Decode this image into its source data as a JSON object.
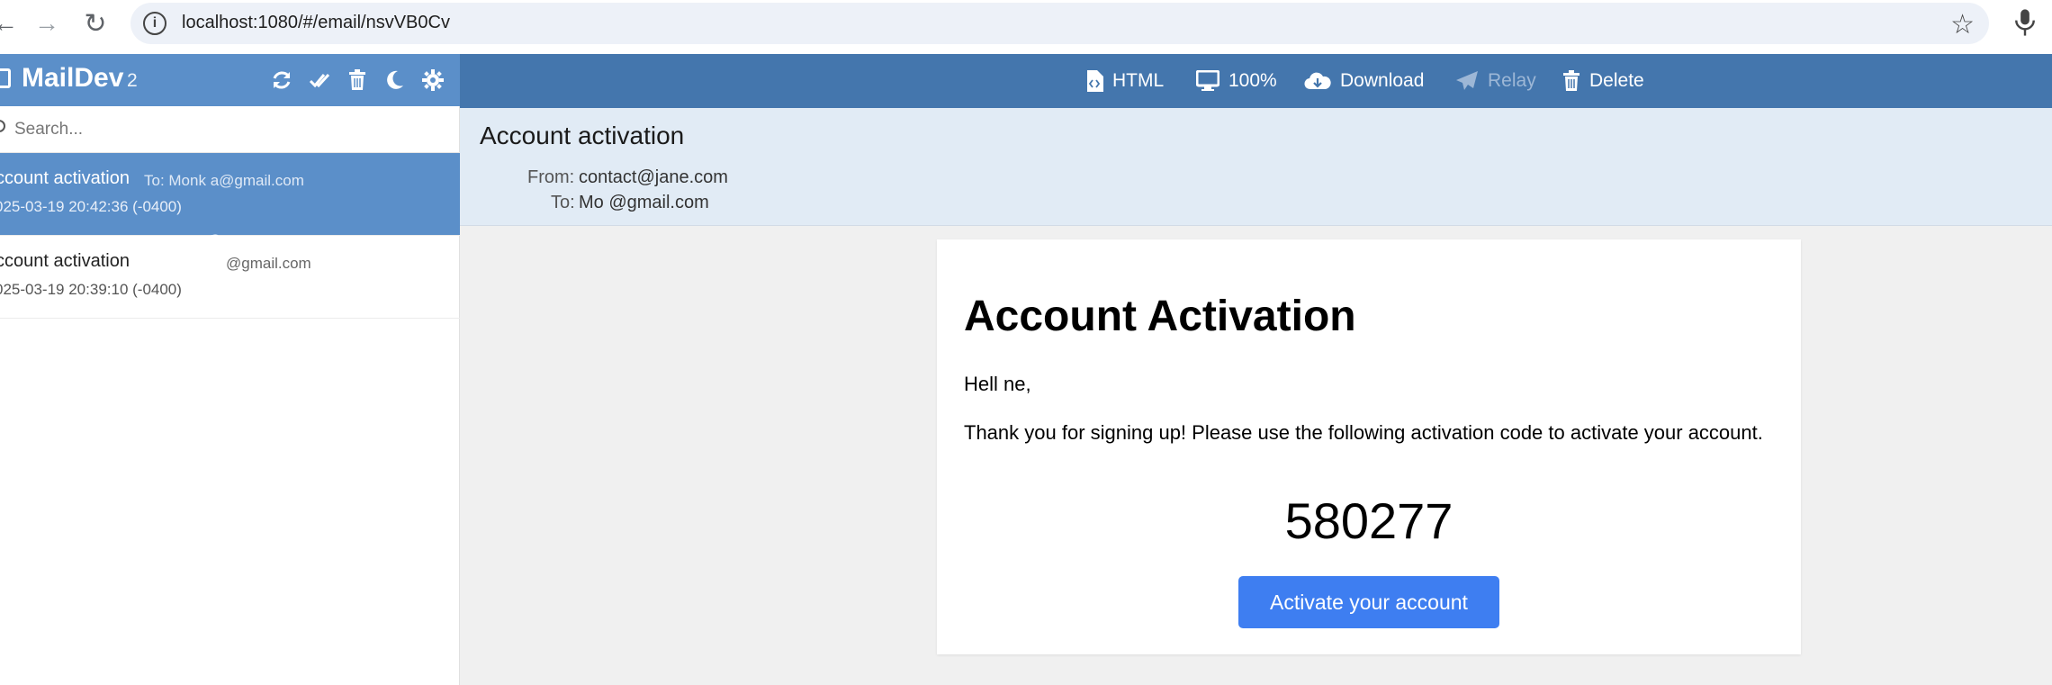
{
  "browser": {
    "url": "localhost:1080/#/email/nsvVB0Cv",
    "back_glyph": "←",
    "forward_glyph": "→",
    "reload_glyph": "↻",
    "site_info_glyph": "i",
    "star_glyph": "☆"
  },
  "sidebar": {
    "brand": "MailDev",
    "count": "2",
    "search_placeholder": "Search...",
    "header_icons": [
      "refresh-icon",
      "mark-all-read-icon",
      "trash-icon",
      "moon-icon",
      "gear-icon"
    ],
    "emails": [
      {
        "subject": "ccount activation",
        "to": "To: Monk   a@gmail.com",
        "date": "025-03-19 20:42:36 (-0400)",
        "active": true
      },
      {
        "subject": "ccount activation",
        "to": "@gmail.com",
        "date": "025-03-19 20:39:10 (-0400)",
        "active": false
      }
    ]
  },
  "toolbar": {
    "html_label": "HTML",
    "zoom_label": "100%",
    "download_label": "Download",
    "relay_label": "Relay",
    "delete_label": "Delete"
  },
  "email": {
    "subject": "Account activation",
    "from_label": "From:",
    "from_value": "contact@jane.com",
    "to_label": "To:",
    "to_value": "Mo    @gmail.com"
  },
  "message": {
    "title": "Account Activation",
    "greeting": "Hell         ne,",
    "body": "Thank you for signing up! Please use the following activation code to activate your account.",
    "code": "580277",
    "button_label": "Activate your account"
  },
  "colors": {
    "sidebar_header": "#5b8fc9",
    "topbar": "#4476ad",
    "email_header_bg": "#e1ebf5",
    "button": "#3e7ef1"
  }
}
